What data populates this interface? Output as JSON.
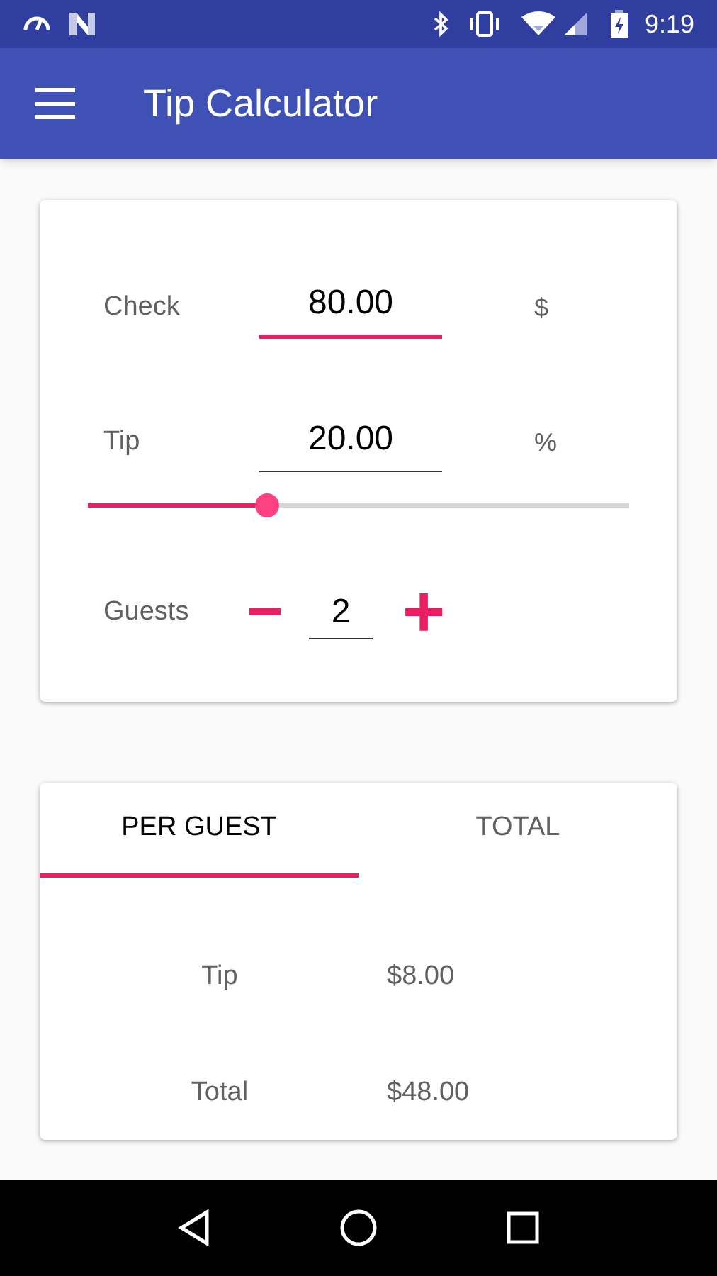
{
  "status_bar": {
    "time": "9:19"
  },
  "toolbar": {
    "title": "Tip Calculator"
  },
  "inputs": [
    {
      "label": "Check",
      "value": "80.00",
      "unit": "$",
      "focused": true
    },
    {
      "label": "Tip",
      "value": "20.00",
      "unit": "%",
      "focused": false
    }
  ],
  "tip_slider": {
    "level": 0.33
  },
  "guests": {
    "label": "Guests",
    "minus": "−",
    "value": "2",
    "plus": "+"
  },
  "tabs": [
    {
      "label": "PER GUEST",
      "selected": true
    },
    {
      "label": "TOTAL",
      "selected": false
    }
  ],
  "results": [
    {
      "label": "Tip",
      "value": "$8.00"
    },
    {
      "label": "Total",
      "value": "$48.00"
    }
  ]
}
